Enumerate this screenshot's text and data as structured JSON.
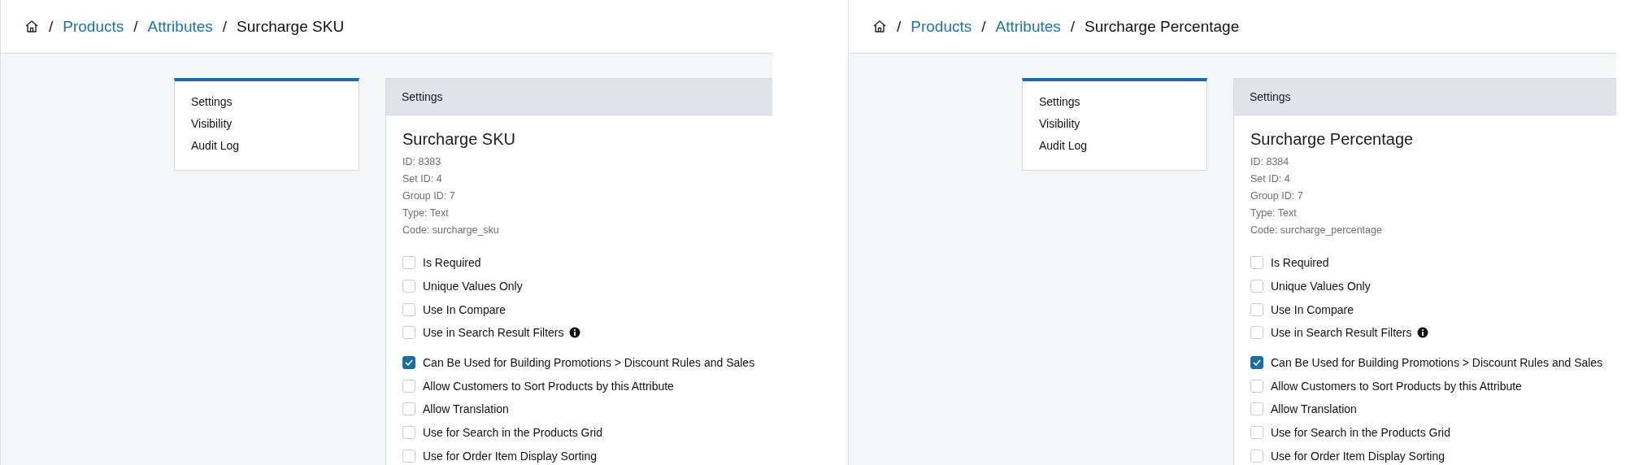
{
  "panes": [
    {
      "breadcrumb": {
        "separator": "/",
        "links": [
          "Products",
          "Attributes"
        ],
        "current": "Surcharge SKU"
      },
      "nav": [
        "Settings",
        "Visibility",
        "Audit Log"
      ],
      "panel_header": "Settings",
      "title": "Surcharge SKU",
      "meta": [
        "ID: 8383",
        "Set ID: 4",
        "Group ID: 7",
        "Type: Text",
        "Code: surcharge_sku"
      ],
      "option_groups": [
        [
          {
            "label": "Is Required",
            "checked": false,
            "has_info": false
          },
          {
            "label": "Unique Values Only",
            "checked": false,
            "has_info": false
          },
          {
            "label": "Use In Compare",
            "checked": false,
            "has_info": false
          },
          {
            "label": "Use in Search Result Filters",
            "checked": false,
            "has_info": true
          }
        ],
        [
          {
            "label": "Can Be Used for Building Promotions > Discount Rules and Sales",
            "checked": true,
            "has_info": false
          },
          {
            "label": "Allow Customers to Sort Products by this Attribute",
            "checked": false,
            "has_info": false
          },
          {
            "label": "Allow Translation",
            "checked": false,
            "has_info": false
          },
          {
            "label": "Use for Search in the Products Grid",
            "checked": false,
            "has_info": false
          },
          {
            "label": "Use for Order Item Display Sorting",
            "checked": false,
            "has_info": false
          }
        ]
      ]
    },
    {
      "breadcrumb": {
        "separator": "/",
        "links": [
          "Products",
          "Attributes"
        ],
        "current": "Surcharge Percentage"
      },
      "nav": [
        "Settings",
        "Visibility",
        "Audit Log"
      ],
      "panel_header": "Settings",
      "title": "Surcharge Percentage",
      "meta": [
        "ID: 8384",
        "Set ID: 4",
        "Group ID: 7",
        "Type: Text",
        "Code: surcharge_percentage"
      ],
      "option_groups": [
        [
          {
            "label": "Is Required",
            "checked": false,
            "has_info": false
          },
          {
            "label": "Unique Values Only",
            "checked": false,
            "has_info": false
          },
          {
            "label": "Use In Compare",
            "checked": false,
            "has_info": false
          },
          {
            "label": "Use in Search Result Filters",
            "checked": false,
            "has_info": true
          }
        ],
        [
          {
            "label": "Can Be Used for Building Promotions > Discount Rules and Sales",
            "checked": true,
            "has_info": false
          },
          {
            "label": "Allow Customers to Sort Products by this Attribute",
            "checked": false,
            "has_info": false
          },
          {
            "label": "Allow Translation",
            "checked": false,
            "has_info": false
          },
          {
            "label": "Use for Search in the Products Grid",
            "checked": false,
            "has_info": false
          },
          {
            "label": "Use for Order Item Display Sorting",
            "checked": false,
            "has_info": false
          }
        ]
      ]
    }
  ]
}
